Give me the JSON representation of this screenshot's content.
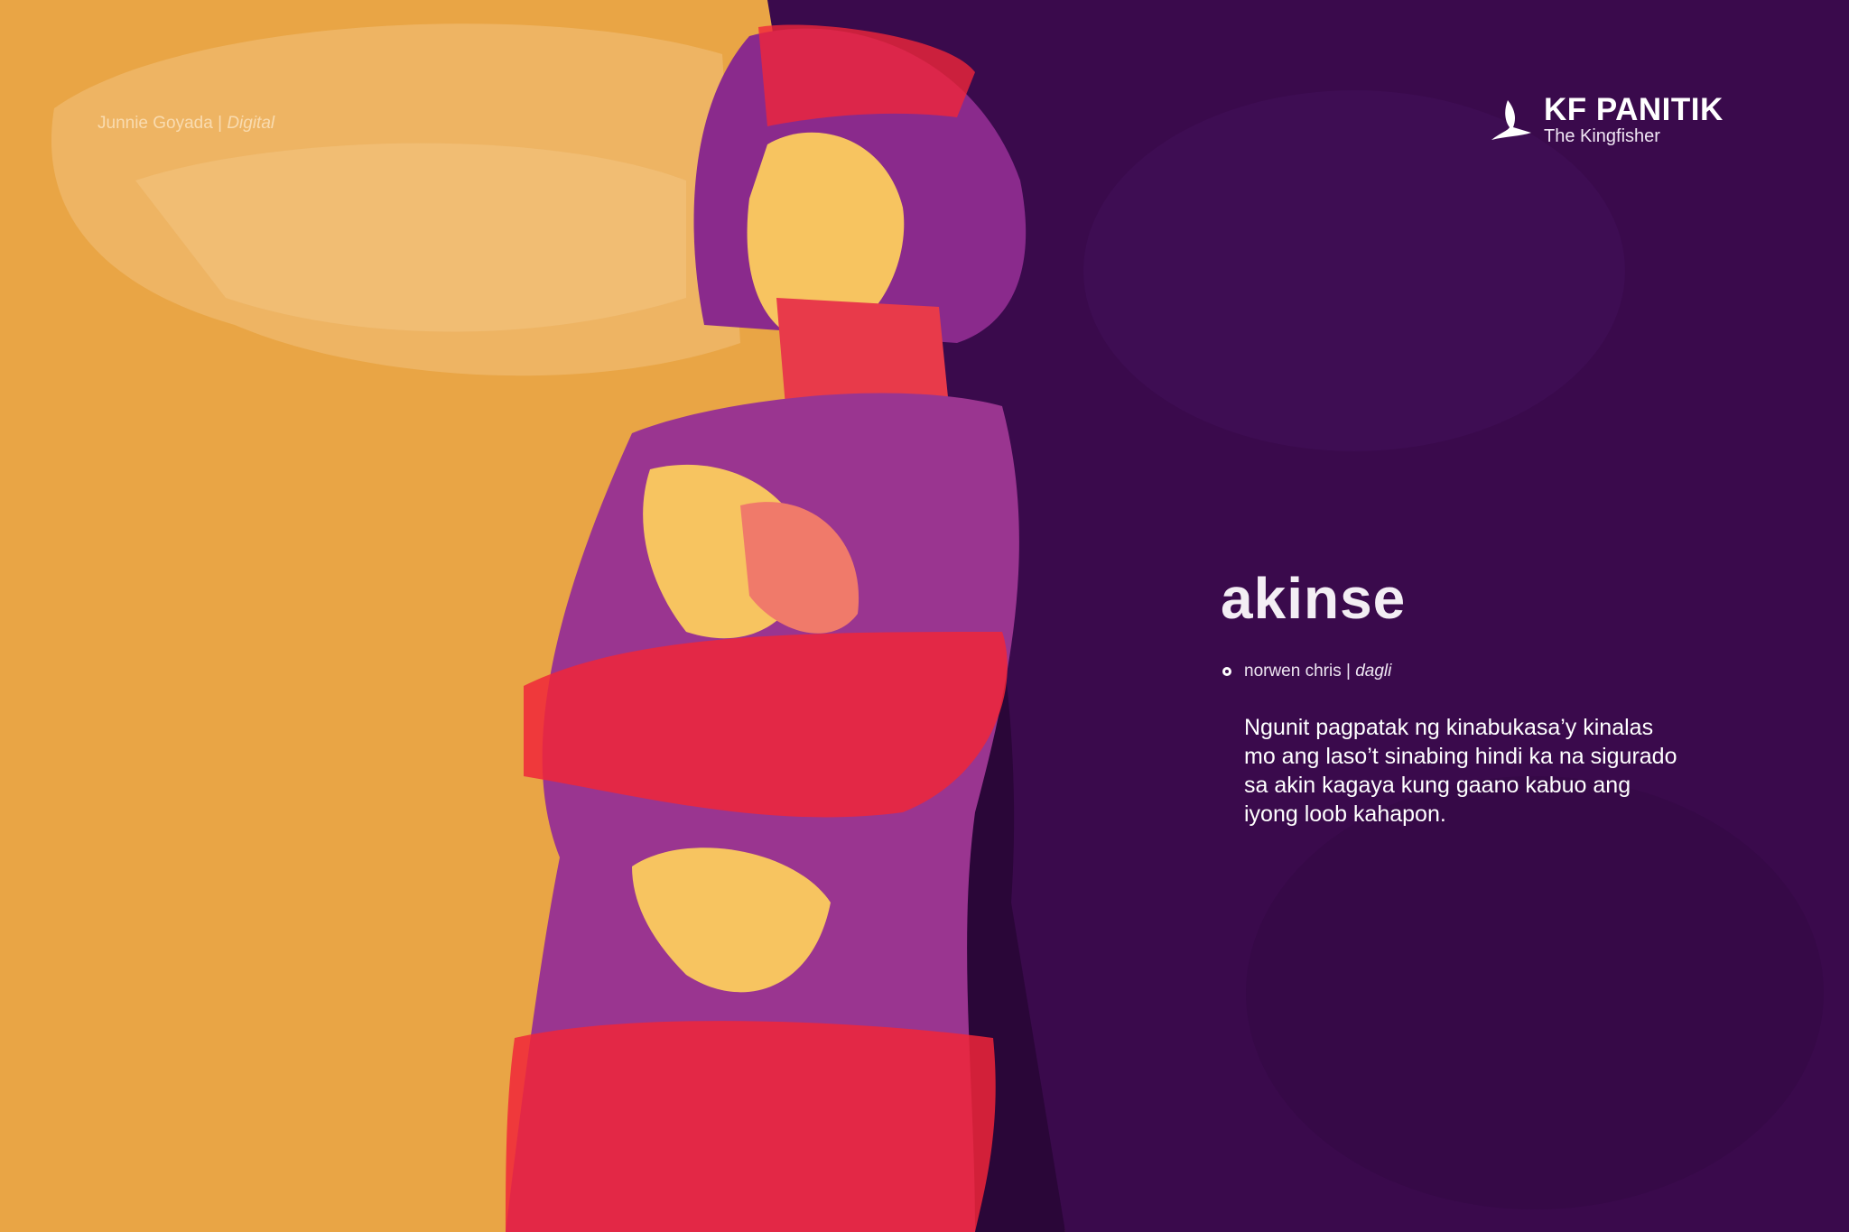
{
  "credit": {
    "artist": "Junnie Goyada",
    "separator": "|",
    "medium": "Digital"
  },
  "logo": {
    "name": "KF PANITIK",
    "tagline": "The Kingfisher",
    "icon": "kingfisher-bird-icon"
  },
  "piece": {
    "title": "akinse",
    "author": "norwen chris",
    "separator": "|",
    "genre": "dagli",
    "excerpt_lines": [
      "Ngunit pagpatak ng kinabukasa’y kinalas",
      "mo ang laso’t sinabing hindi ka na sigurado",
      "sa akin kagaya kung gaano kabuo ang",
      "iyong loob kahapon."
    ]
  },
  "colors": {
    "orange": "#e9a545",
    "purple": "#3a0a4c",
    "red": "#f0263a",
    "magenta": "#8a2a8c",
    "yellow": "#f7c460"
  }
}
